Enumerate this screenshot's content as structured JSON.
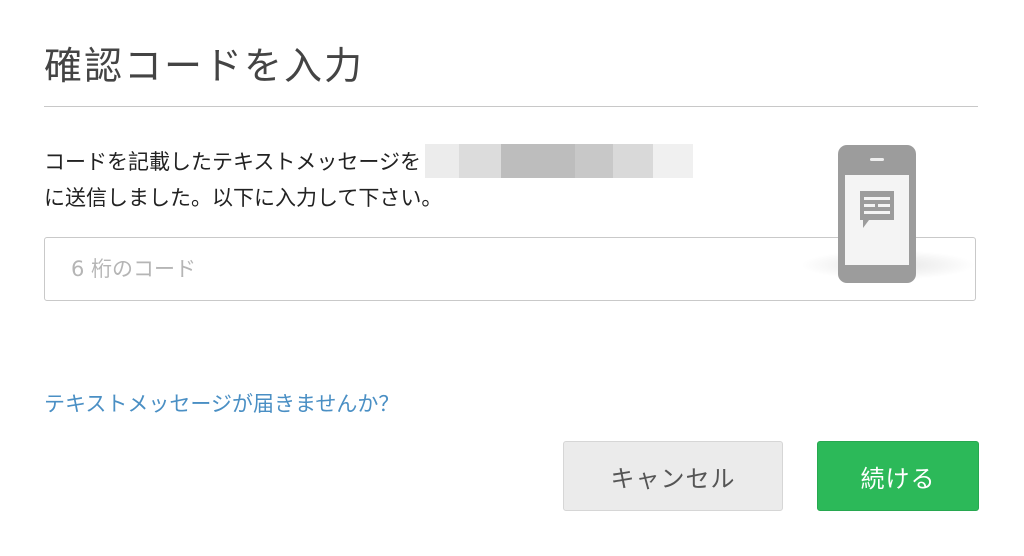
{
  "dialog": {
    "title": "確認コードを入力",
    "message_line1": "コードを記載したテキストメッセージを",
    "message_line2": "に送信しました。以下に入力して下さい。",
    "code_input": {
      "placeholder": "6 桁のコード",
      "value": ""
    },
    "resend_link": "テキストメッセージが届きませんか？",
    "cancel_label": "キャンセル",
    "continue_label": "続ける"
  },
  "icons": {
    "phone": "phone-message-icon",
    "chat": "chat-bubble-icon"
  },
  "colors": {
    "accent_green": "#2cb959",
    "link_blue": "#4a8fc4",
    "cancel_gray": "#ebebeb",
    "phone_gray": "#9c9c9c"
  }
}
